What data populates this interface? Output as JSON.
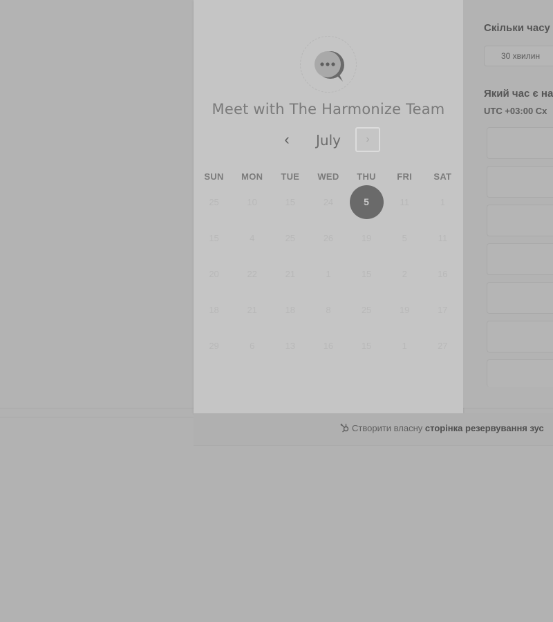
{
  "meeting": {
    "title": "Meet with The Harmonize Team"
  },
  "calendar": {
    "month": "July",
    "prev_label": "‹",
    "next_label": "›",
    "weekdays": [
      "SUN",
      "MON",
      "TUE",
      "WED",
      "THU",
      "FRI",
      "SAT"
    ],
    "weeks": [
      [
        "25",
        "10",
        "15",
        "24",
        "5",
        "11",
        "1"
      ],
      [
        "15",
        "4",
        "25",
        "26",
        "19",
        "5",
        "11"
      ],
      [
        "20",
        "22",
        "21",
        "1",
        "15",
        "2",
        "16"
      ],
      [
        "18",
        "21",
        "18",
        "8",
        "25",
        "19",
        "17"
      ],
      [
        "29",
        "6",
        "13",
        "16",
        "15",
        "1",
        "27"
      ]
    ],
    "selected_day": "5"
  },
  "booking": {
    "duration_heading": "Скільки часу",
    "duration_option": "30 хвилин",
    "time_heading": "Який час є на",
    "timezone": "UTC +03:00 Сх"
  },
  "footer": {
    "prefix": "Створити власну",
    "link_bold": "сторінка резервування зус"
  },
  "colors": {
    "selected_day_bg": "#6a6a6a",
    "card_bg": "#c5c5c5",
    "page_bg": "#b2b2b2"
  },
  "icons": [
    "chat-bubble-logo-icon",
    "chevron-left-icon",
    "chevron-right-icon",
    "hubspot-sprocket-icon"
  ]
}
